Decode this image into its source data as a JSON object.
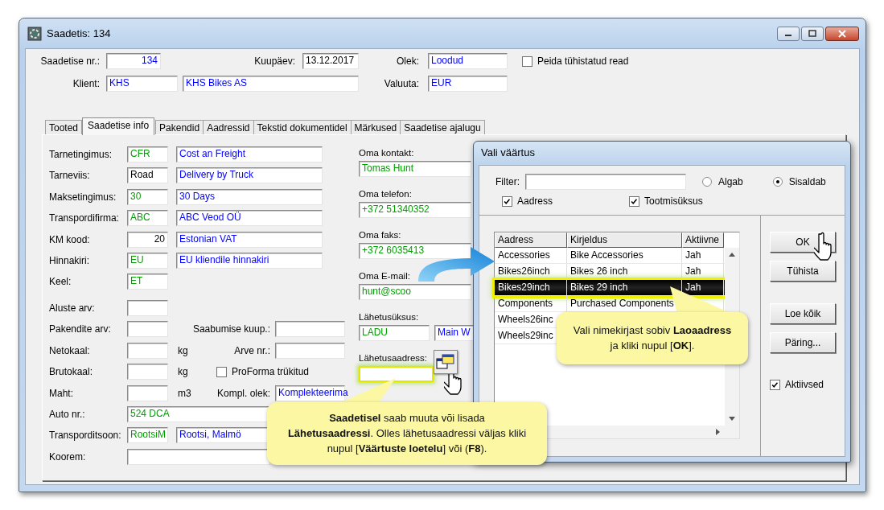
{
  "window": {
    "title": "Saadetis: 134"
  },
  "header": [
    {
      "label": "Saadetise nr.:",
      "fields": [
        {
          "text": "134",
          "color": "#0000ff",
          "right_aligned": true
        }
      ]
    },
    {
      "label": "Kuupäev:",
      "fields": [
        {
          "text": "13.12.2017",
          "color": "#000000"
        }
      ]
    },
    {
      "label": "Olek:",
      "fields": [
        {
          "text": "Loodud",
          "color": "#0000ff"
        }
      ]
    },
    {
      "label": "Klient:",
      "fields": [
        {
          "text": "KHS",
          "color": "#0000ff"
        },
        {
          "text": "KHS Bikes AS",
          "color": "#0000ff"
        }
      ]
    },
    {
      "label": "Valuuta:",
      "fields": [
        {
          "text": "EUR",
          "color": "#0000ff"
        }
      ]
    }
  ],
  "hide_cancelled": {
    "label": "Peida tühistatud read",
    "checked": false
  },
  "tabs": [
    {
      "label": "Tooted",
      "selected": false
    },
    {
      "label": "Saadetise info",
      "selected": true
    },
    {
      "label": "Pakendid",
      "selected": false
    },
    {
      "label": "Aadressid",
      "selected": false
    },
    {
      "label": "Tekstid dokumentidel",
      "selected": false
    },
    {
      "label": "Märkused",
      "selected": false
    },
    {
      "label": "Saadetise ajalugu",
      "selected": false
    }
  ],
  "detail_groups": [
    {
      "rows": [
        {
          "kind": "lookup",
          "label": "Tarnetingimus:",
          "code": {
            "text": "CFR",
            "color": "#00a000"
          },
          "name": {
            "text": "Cost an Freight",
            "color": "#0000ff"
          }
        },
        {
          "kind": "lookup",
          "label": "Tarneviis:",
          "code": {
            "text": "Road",
            "color": "#000000"
          },
          "name": {
            "text": "Delivery by Truck",
            "color": "#0000ff"
          }
        },
        {
          "kind": "lookup",
          "label": "Maksetingimus:",
          "code": {
            "text": "30",
            "color": "#00a000"
          },
          "name": {
            "text": "30 Days",
            "color": "#0000ff"
          }
        },
        {
          "kind": "lookup",
          "label": "Transpordifirma:",
          "code": {
            "text": "ABC",
            "color": "#00a000"
          },
          "name": {
            "text": "ABC Veod OÜ",
            "color": "#0000ff"
          }
        },
        {
          "kind": "lookup",
          "label": "KM kood:",
          "code": {
            "text": "20",
            "color": "#000000",
            "right_aligned": true
          },
          "name": {
            "text": "Estonian VAT",
            "color": "#0000ff"
          }
        },
        {
          "kind": "lookup",
          "label": "Hinnakiri:",
          "code": {
            "text": "EU",
            "color": "#00a000"
          },
          "name": {
            "text": "EU kliendile hinnakiri",
            "color": "#0000ff"
          }
        },
        {
          "kind": "lookup",
          "label": "Keel:",
          "code": {
            "text": "ET",
            "color": "#00a000"
          }
        }
      ]
    },
    {
      "rows": [
        {
          "kind": "lookup",
          "label": "Aluste arv:"
        },
        {
          "kind": "lookup",
          "label": "Pakendite arv:",
          "side": {
            "kind": "field",
            "label": "Saabumise kuup.:"
          }
        },
        {
          "kind": "lookup",
          "label": "Netokaal:",
          "unit": "kg",
          "side": {
            "kind": "field",
            "label": "Arve nr.:"
          }
        },
        {
          "kind": "lookup",
          "label": "Brutokaal:",
          "unit": "kg",
          "side": {
            "kind": "checkbox",
            "label": "ProForma trükitud",
            "checked": false
          }
        },
        {
          "kind": "lookup",
          "label": "Maht:",
          "unit": "m3",
          "side": {
            "kind": "field",
            "label": "Kompl. olek:",
            "value": {
              "text": "Komplekteerima",
              "color": "#0000ff"
            }
          }
        },
        {
          "kind": "wide",
          "label": "Auto nr.:",
          "code": {
            "text": "524 DCA",
            "color": "#00a000"
          }
        },
        {
          "kind": "lookup",
          "label": "Transporditsoon:",
          "code": {
            "text": "RootsiM",
            "color": "#00a000"
          },
          "name": {
            "text": "Rootsi, Malmö",
            "color": "#0000ff"
          }
        },
        {
          "kind": "wide",
          "label": "Koorem:"
        }
      ]
    }
  ],
  "contacts": [
    {
      "label": "Oma kontakt:",
      "fields": [
        {
          "text": "Tomas Hunt",
          "color": "#00a000"
        }
      ]
    },
    {
      "label": "Oma telefon:",
      "fields": [
        {
          "text": "+372 51340352",
          "color": "#00a000"
        }
      ]
    },
    {
      "label": "Oma faks:",
      "fields": [
        {
          "text": "+372 6035413",
          "color": "#00a000"
        }
      ]
    },
    {
      "label": "Oma E-mail:",
      "fields": [
        {
          "text": "hunt@scoo",
          "color": "#00a000"
        }
      ]
    },
    {
      "label": "Lähetusüksus:",
      "fields": [
        {
          "text": "LADU",
          "color": "#00a000"
        },
        {
          "text": "Main W",
          "color": "#0000ff"
        }
      ]
    },
    {
      "label": "Lähetusaadress:",
      "highlighted": true,
      "lookup_button": true
    }
  ],
  "dialog": {
    "title": "Vali väärtus",
    "filter_label": "Filter:",
    "match_modes": [
      {
        "label": "Algab",
        "selected": false
      },
      {
        "label": "Sisaldab",
        "selected": true
      }
    ],
    "scopes": [
      {
        "label": "Aadress",
        "checked": true
      },
      {
        "label": "Tootmisüksus",
        "checked": true
      }
    ],
    "columns": [
      "Aadress",
      "Kirjeldus",
      "Aktiivne"
    ],
    "rows": [
      {
        "cells": [
          "Accessories",
          "Bike Accessories",
          "Jah"
        ],
        "selected": false
      },
      {
        "cells": [
          "Bikes26inch",
          "Bikes 26 inch",
          "Jah"
        ],
        "selected": false
      },
      {
        "cells": [
          "Bikes29inch",
          "Bikes 29 inch",
          "Jah"
        ],
        "selected": true
      },
      {
        "cells": [
          "Components",
          "Purchased Components"
        ],
        "selected": false
      },
      {
        "cells": [
          "Wheels26inc"
        ],
        "selected": false
      },
      {
        "cells": [
          "Wheels29inc"
        ],
        "selected": false
      }
    ],
    "buttons": [
      "OK",
      "Tühista",
      "Loe kõik",
      "Päring..."
    ],
    "active_only": {
      "label": "Aktiivsed",
      "checked": true
    }
  },
  "callouts": [
    {
      "text": "**Saadetisel** saab muuta või lisada **Lähetusaadressi**. Olles lähetusaadressi väljas kliki nupul [**Väärtuste loetelu**] või (**F8**)."
    },
    {
      "text": "Vali nimekirjast sobiv **Laoaadress** ja kliki nupul [**OK**]."
    }
  ]
}
